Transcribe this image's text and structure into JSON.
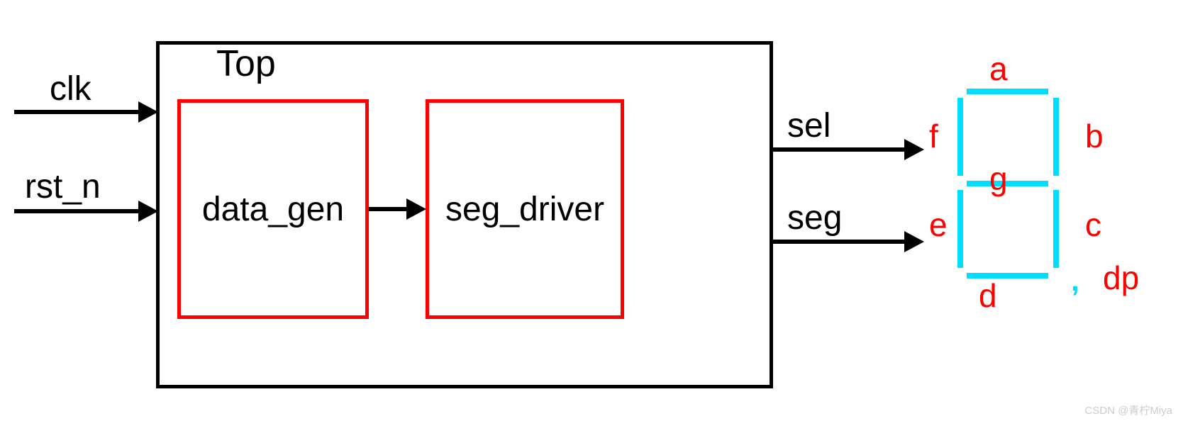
{
  "top_module": {
    "label": "Top",
    "blocks": {
      "data_gen": "data_gen",
      "seg_driver": "seg_driver"
    }
  },
  "inputs": {
    "clk": "clk",
    "rst_n": "rst_n"
  },
  "outputs": {
    "sel": "sel",
    "seg": "seg"
  },
  "seven_segment": {
    "a": "a",
    "b": "b",
    "c": "c",
    "d": "d",
    "e": "e",
    "f": "f",
    "g": "g",
    "dp": "dp"
  },
  "watermark": "CSDN @青柠Miya"
}
